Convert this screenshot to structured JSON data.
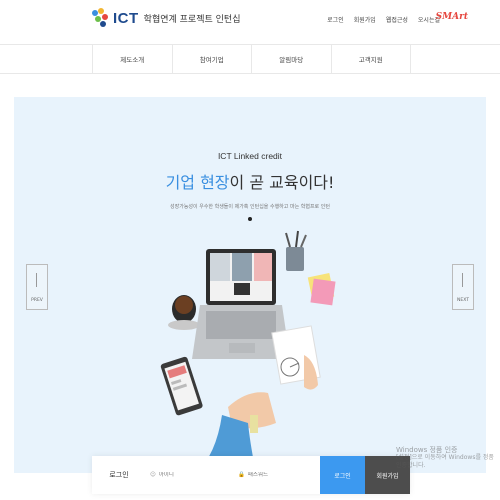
{
  "header": {
    "logo_text": "ICT",
    "logo_subtitle": "학협연계 프로젝트 인턴십",
    "links": [
      "로그인",
      "회원가입",
      "웹접근성",
      "오시는길"
    ],
    "badge": "SMArt"
  },
  "nav": {
    "items": [
      "제도소개",
      "참여기업",
      "알림마당",
      "고객지원"
    ]
  },
  "hero": {
    "kicker": "ICT Linked credit",
    "title_highlight": "기업 현장",
    "title_rest": "이 곧 교육이다!",
    "subtitle": "성장가능성이 우수한 학생들이 제가혹 인턴십을 수행하고 마는 학협프로 인턴",
    "prev_label": "PREV",
    "next_label": "NEXT"
  },
  "login": {
    "title": "로그인",
    "id_placeholder": "아이디",
    "pw_placeholder": "패스워드",
    "login_button": "로그인",
    "join_button": "회원가입"
  },
  "watermark": {
    "line1": "Windows 정품 인증",
    "line2": "[설정]으로 이동하여 Windows를 정품 인증합니다."
  },
  "colors": {
    "accent": "#3a8fe0",
    "hero_bg": "#e8f3fc",
    "login_button": "#3c99f0",
    "join_button": "#4d4d4d"
  }
}
